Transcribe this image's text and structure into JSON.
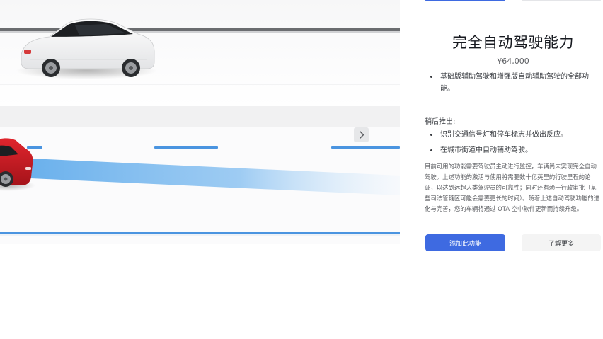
{
  "option": {
    "title": "完全自动驾驶能力",
    "price": "¥64,000",
    "features": [
      "基础版辅助驾驶和增强版自动辅助驾驶的全部功能。"
    ],
    "coming_later_label": "稍后推出:",
    "coming_later": [
      "识别交通信号灯和停车标志并做出反应。",
      "在城市街道中自动辅助驾驶。"
    ],
    "disclaimer": "目前可用的功能需要驾驶员主动进行监控，车辆尚未实现完全自动驾驶。上述功能的激活与使用将需要数十亿英里的行驶里程的论证，以达到远超人类驾驶员的可靠性；同时还有赖于行政审批（某些司法管辖区可能会需要更长的时间）。随着上述自动驾驶功能的进化与完善，您的车辆将通过 OTA 空中软件更新而持续升级。"
  },
  "buttons": {
    "add_feature": "添加此功能",
    "learn_more": "了解更多"
  },
  "illustration": {
    "white_car": "white-model-x",
    "red_car": "red-model-x",
    "next_icon": "chevron-right-icon",
    "colors": {
      "path": "#5aa8ea",
      "lane": "#4a94e0",
      "accent": "#3e6ae1"
    }
  }
}
